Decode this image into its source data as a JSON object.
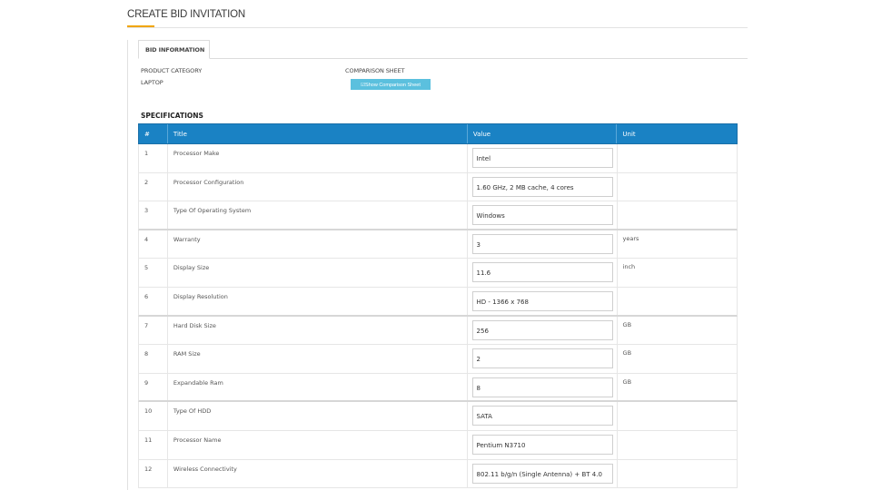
{
  "page": {
    "title": "CREATE BID INVITATION",
    "accent_color": "#f0a500",
    "header_color": "#1a82c4",
    "button_color": "#5bc0de"
  },
  "tabs": [
    {
      "label": "BID INFORMATION",
      "active": true
    }
  ],
  "bid_info": {
    "product_category_label": "PRODUCT CATEGORY",
    "product_category_value": "LAPTOP",
    "comparison_sheet_label": "COMPARISON SHEET",
    "comparison_button_icon": "chart-icon",
    "comparison_button_label": "☑Show Comparison Sheet"
  },
  "specifications": {
    "heading": "SPECIFICATIONS",
    "columns": [
      "#",
      "Title",
      "Value",
      "Unit"
    ],
    "rows": [
      {
        "num": "1",
        "title": "Processor Make",
        "value": "Intel",
        "unit": ""
      },
      {
        "num": "2",
        "title": "Processor Configuration",
        "value": "1.60 GHz, 2 MB cache, 4 cores",
        "unit": ""
      },
      {
        "num": "3",
        "title": "Type Of Operating System",
        "value": "Windows",
        "unit": ""
      },
      {
        "num": "4",
        "title": "Warranty",
        "value": "3",
        "unit": "years"
      },
      {
        "num": "5",
        "title": "Display Size",
        "value": "11.6",
        "unit": "inch"
      },
      {
        "num": "6",
        "title": "Display Resolution",
        "value": "HD - 1366 x 768",
        "unit": ""
      },
      {
        "num": "7",
        "title": "Hard Disk Size",
        "value": "256",
        "unit": "GB"
      },
      {
        "num": "8",
        "title": "RAM Size",
        "value": "2",
        "unit": "GB"
      },
      {
        "num": "9",
        "title": "Expandable Ram",
        "value": "8",
        "unit": "GB"
      },
      {
        "num": "10",
        "title": "Type Of HDD",
        "value": "SATA",
        "unit": ""
      },
      {
        "num": "11",
        "title": "Processor Name",
        "value": "Pentium N3710",
        "unit": ""
      },
      {
        "num": "12",
        "title": "Wireless Connectivity",
        "value": "802.11 b/g/n (Single Antenna) + BT 4.0",
        "unit": ""
      }
    ]
  }
}
